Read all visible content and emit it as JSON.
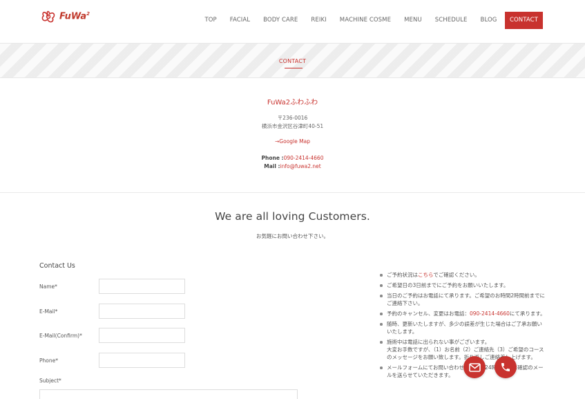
{
  "header": {
    "logo_text": "FuWa",
    "logo_sup": "2",
    "nav": [
      "TOP",
      "FACIAL",
      "BODY CARE",
      "REIKI",
      "MACHINE COSME",
      "MENU",
      "SCHEDULE",
      "BLOG"
    ],
    "nav_active": "CONTACT"
  },
  "banner": {
    "title": "CONTACT"
  },
  "shop": {
    "name": "FuWa2ふわふわ",
    "postal": "〒236-0016",
    "address": "横浜市金沢区谷津町40-51",
    "map_link": "→Google Map",
    "phone_label": "Phone :",
    "phone": "090-2414-4660",
    "mail_label": "Mail :",
    "mail": "info@fuwa2.net"
  },
  "headline": "We are all loving Customers.",
  "subline": "お気軽にお問い合わせ下さい。",
  "form": {
    "title": "Contact Us",
    "name_label": "Name*",
    "email_label": "E-Mail*",
    "email_confirm_label": "E-Mail(Confirm)*",
    "phone_label": "Phone*",
    "subject_label": "Subject*"
  },
  "notes": {
    "n1_pre": "ご予約状況は",
    "n1_link": "こちら",
    "n1_post": "でご確認ください。",
    "n2": "ご希望日の3日前までにご予約をお願いいたします。",
    "n3": "当日のご予約はお電話にて承ります。ご希望のお時間2時間前までにご連絡下さい。",
    "n4_pre": "予約のキャンセル、変更はお電話：",
    "n4_phone": "090-2414-4660",
    "n4_post": "にて承ります。",
    "n5": "随時、更新いたしますが、多少の誤差が生じた場合はご了承お願いいたします。",
    "n6a": "施術中は電話に出られない事がございます。",
    "n6b": "大変お手数ですが、（1）お名前（2）ご連絡先（3）ご希望のコースのメッセージをお願い致します。折り返しご連絡差し上げます。",
    "n7": "メールフォームにてお問い合わせの場合、24時間以内に確認のメールを送らせていただきます。"
  },
  "icons": {
    "mail": "mail-icon",
    "phone": "phone-icon",
    "logo": "flower-logo-icon"
  },
  "colors": {
    "accent": "#c8322e"
  }
}
